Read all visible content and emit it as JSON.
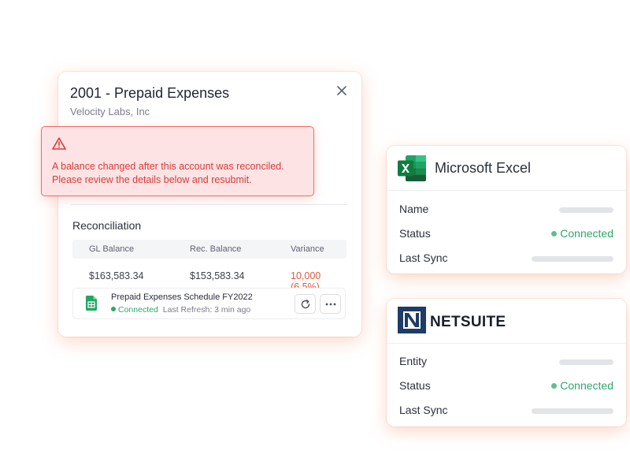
{
  "account_card": {
    "title": "2001 - Prepaid Expenses",
    "subtitle": "Velocity Labs, Inc",
    "alert": {
      "line1": "A balance changed after this account was reconciled.",
      "line2": "Please review the details below and resubmit."
    },
    "section_title": "Reconciliation",
    "table": {
      "headers": [
        "GL Balance",
        "Rec. Balance",
        "Variance"
      ],
      "row": [
        "$163,583.34",
        "$153,583.34",
        "10,000 (6.5%)"
      ]
    },
    "attachment": {
      "name": "Prepaid Expenses Schedule FY2022",
      "status": "Connected",
      "last_refresh": "Last Refresh: 3 min ago"
    }
  },
  "excel_card": {
    "name": "Microsoft Excel",
    "rows": [
      {
        "label": "Name"
      },
      {
        "label": "Status",
        "value": "Connected"
      },
      {
        "label": "Last Sync"
      }
    ]
  },
  "netsuite_card": {
    "logo_text": "NETSUITE",
    "rows": [
      {
        "label": "Entity"
      },
      {
        "label": "Status",
        "value": "Connected"
      },
      {
        "label": "Last Sync"
      }
    ]
  },
  "colors": {
    "accent_green": "#2ea86a",
    "alert_red": "#d93a3a",
    "alert_bg": "#fde3e3",
    "variance": "#e2593b",
    "excel_green": "#1d6f42",
    "netsuite_navy": "#1f3c66"
  },
  "icons": {
    "close": "close-icon",
    "warning": "warning-icon",
    "sheet": "google-sheets-icon",
    "refresh": "refresh-icon",
    "more": "more-horizontal-icon",
    "excel": "excel-logo-icon",
    "netsuite": "netsuite-logo-icon"
  }
}
